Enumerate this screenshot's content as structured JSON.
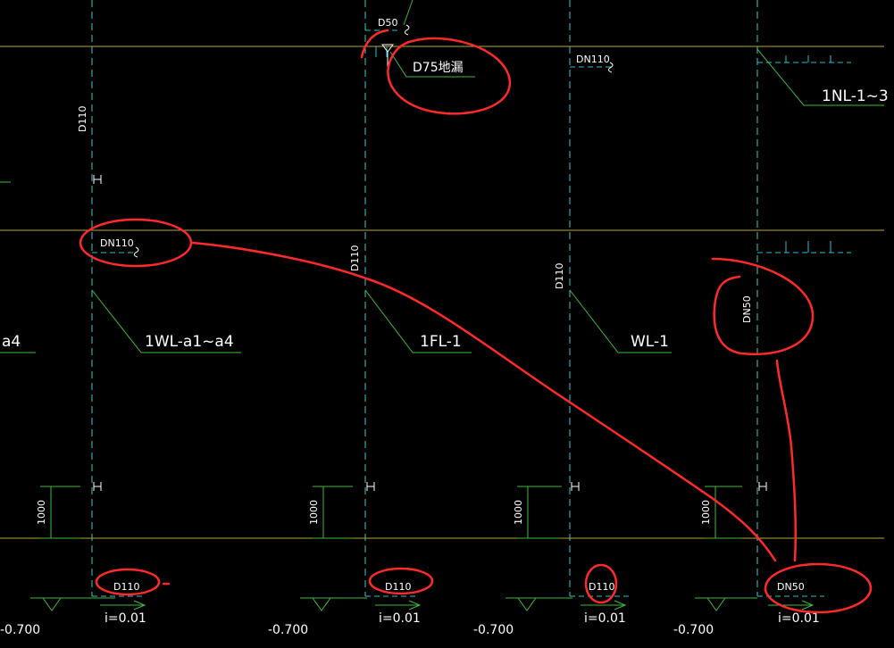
{
  "colors": {
    "background": "#000000",
    "axis": "#3fc7c7",
    "floor": "#b8a83a",
    "leader": "#3fb83f",
    "pipe": "#27c4cf",
    "text": "#ffffff",
    "markup": "#ff2a2a"
  },
  "labels": {
    "d50_top": "D50",
    "d75_drain": "D75地漏",
    "dn110_right": "DN110",
    "nl_1_3": "1NL-1~3",
    "d110_col1": "D110",
    "dn110_left": "DN110",
    "d110_col2": "D110",
    "d110_col3": "D110",
    "dn50_col4": "DN50",
    "wl_a4_left": "a4",
    "wl_1a1_a4": "1WL-a1~a4",
    "fl_1": "1FL-1",
    "wl_1": "WL-1",
    "dim_1": "1000",
    "dim_2": "1000",
    "dim_3": "1000",
    "dim_4": "1000",
    "pipe_1": "D110",
    "pipe_2": "D110",
    "pipe_3": "D110",
    "pipe_4": "DN50",
    "slope_1": "i=0.01",
    "slope_2": "i=0.01",
    "slope_3": "i=0.01",
    "slope_4": "i=0.01",
    "elev_1": "-0.700",
    "elev_2": "-0.700",
    "elev_3": "-0.700",
    "elev_4": "-0.700"
  }
}
